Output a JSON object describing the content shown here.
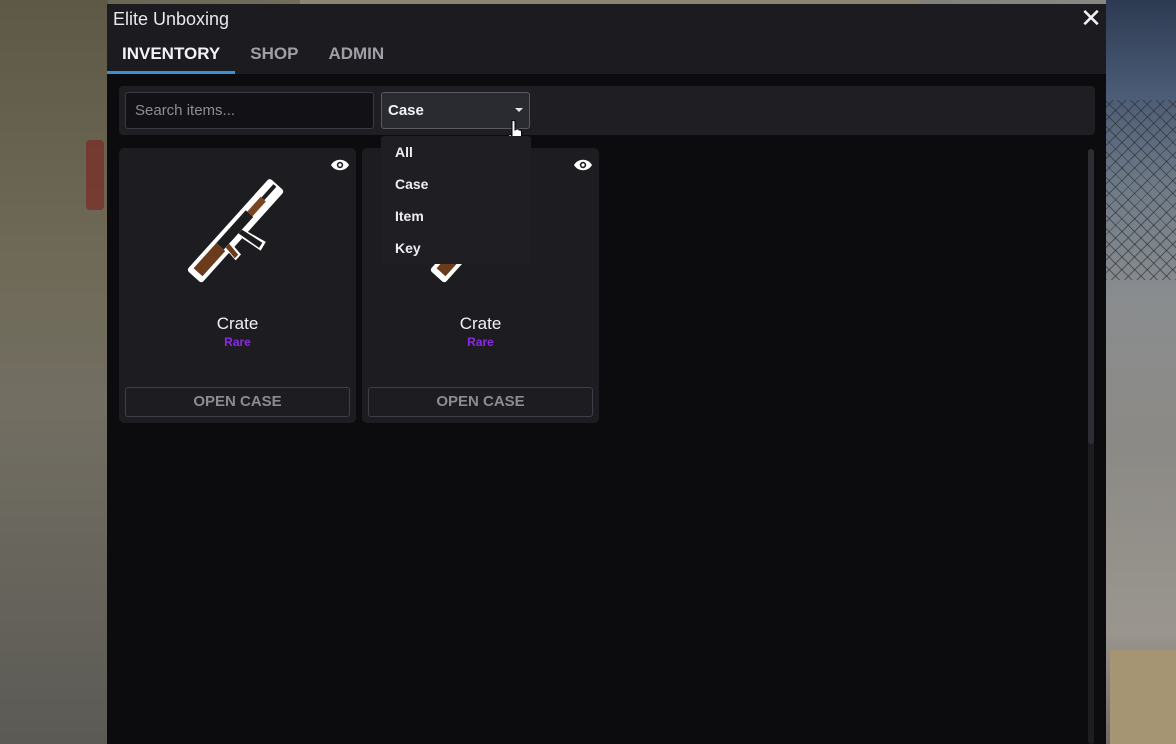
{
  "window": {
    "title": "Elite Unboxing",
    "close_symbol": "✕"
  },
  "tabs": [
    {
      "label": "INVENTORY",
      "active": true
    },
    {
      "label": "SHOP",
      "active": false
    },
    {
      "label": "ADMIN",
      "active": false
    }
  ],
  "toolbar": {
    "search_placeholder": "Search items...",
    "filter_selected": "Case",
    "filter_options": [
      "All",
      "Case",
      "Item",
      "Key"
    ]
  },
  "items": [
    {
      "name": "Crate",
      "rarity": "Rare",
      "action": "OPEN CASE"
    },
    {
      "name": "Crate",
      "rarity": "Rare",
      "action": "OPEN CASE"
    }
  ],
  "colors": {
    "accent": "#3a8fd9",
    "rarity_rare": "#8a2be2",
    "panel": "#1c1c21",
    "background": "#0c0c0f"
  },
  "icons": [
    "close-icon",
    "chevron-down-icon",
    "eye-icon",
    "rifle-icon",
    "pointer-cursor-icon"
  ]
}
